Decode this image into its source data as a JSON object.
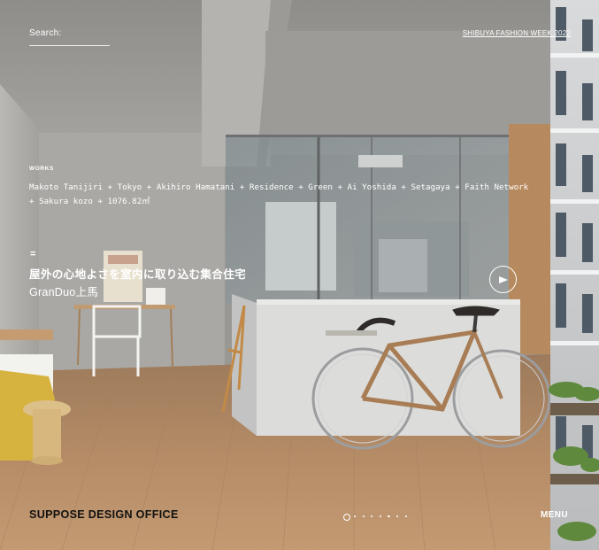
{
  "header": {
    "search_label": "Search:",
    "top_link": "SHIBUYA FASHION WEEK 2022"
  },
  "work": {
    "kicker": "WORKS",
    "credits": "Makoto Tanijiri + Tokyo + Akihiro Hamatani + Residence + Green + Ai Yoshida + Setagaya + Faith Network + Sakura kozo + 1076.82㎡",
    "equals": "=",
    "title_jp": "屋外の心地よさを室内に取り込む集合住宅",
    "subtitle": "GranDuo上馬"
  },
  "footer": {
    "brand": "SUPPOSE DESIGN OFFICE",
    "menu": "MENU"
  },
  "slider": {
    "total": 8,
    "current": 1
  },
  "icons": {
    "play": "play-icon",
    "arrow": "arrow-right-icon"
  },
  "colors": {
    "overlay_text": "#ffffff",
    "brand_text": "#111111",
    "floor": "#b98e67",
    "concrete": "#a7a6a2"
  }
}
